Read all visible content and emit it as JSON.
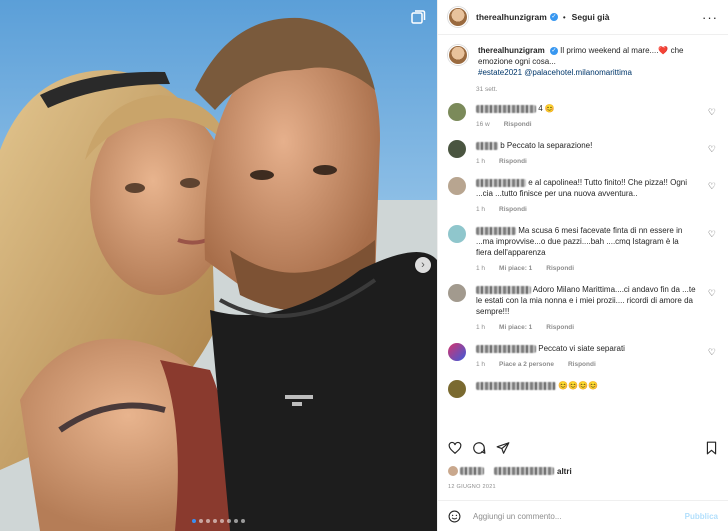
{
  "header": {
    "username": "therealhunzigram",
    "follow_label": "Segui già",
    "more_icon": "ellipsis-icon"
  },
  "caption": {
    "username": "therealhunzigram",
    "text": "Il primo weekend al mare....❤️ che emozione ogni cosa...",
    "tags": "#estate2021 @palacehotel.milanomarittima",
    "time": "31 sett."
  },
  "comments": [
    {
      "text_suffix": "4 😊",
      "time": "16 w",
      "reply": "Rispondi",
      "likes": ""
    },
    {
      "text_prefix": "b",
      "text": "Peccato la separazione!",
      "time": "1 h",
      "reply": "Rispondi",
      "likes": ""
    },
    {
      "text": "e al capolinea!! Tutto finito!! Che pizza!! Ogni ...cia ...tutto finisce per una nuova avventura..",
      "time": "1 h",
      "reply": "Rispondi",
      "likes": ""
    },
    {
      "text": "Ma scusa 6 mesi facevate finta di nn essere in ...ma improvvise...o due pazzi....bah ....cmq Istagram è la fiera dell'apparenza",
      "time": "1 h",
      "reply": "Rispondi",
      "likes": "Mi piace: 1"
    },
    {
      "text": "Adoro Milano Marittima....ci andavo fin da ...te le estati con la mia nonna e i miei prozii.... ricordi di amore da sempre!!!",
      "time": "1 h",
      "reply": "Rispondi",
      "likes": "Mi piace: 1"
    },
    {
      "text": "Peccato vi siate separati",
      "time": "1 h",
      "reply": "Rispondi",
      "likes": "Piace a 2 persone"
    },
    {
      "text": "😊😊😊😊",
      "time": "",
      "reply": "",
      "likes": ""
    }
  ],
  "likes_line": {
    "suffix": "altri"
  },
  "date": "12 GIUGNO 2021",
  "add_comment": {
    "placeholder": "Aggiungi un commento...",
    "publish": "Pubblica"
  },
  "colors": {
    "accent": "#3897f0",
    "heart_red": "#ed4956",
    "muted": "#8e8e8e"
  }
}
